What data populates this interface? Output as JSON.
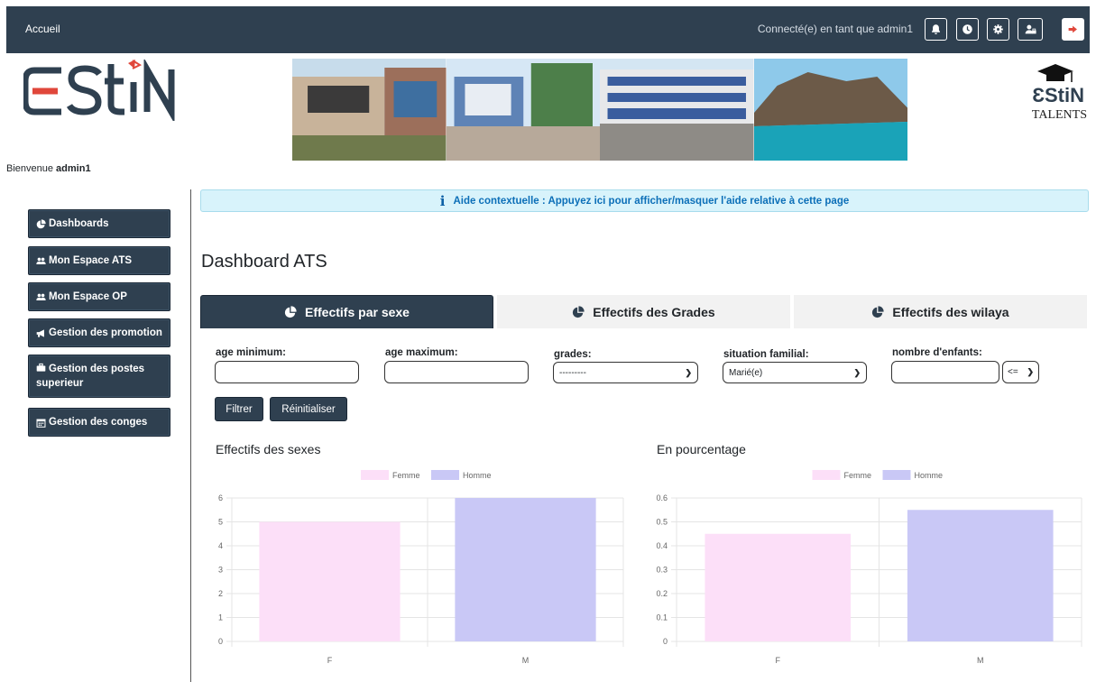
{
  "navbar": {
    "home_label": "Accueil",
    "connected_text": "Connecté(e) en tant que admin1",
    "icons": [
      "bell-icon",
      "clock-icon",
      "gear-icon",
      "user-admin-icon",
      "logout-icon"
    ]
  },
  "header": {
    "logo_text": "ƐStiN",
    "talents_logo_text": "ƐStiN",
    "talents_sub": "TALENTS",
    "welcome_prefix": "Bienvenue ",
    "welcome_user": "admin1"
  },
  "sidebar": {
    "items": [
      {
        "label": "Dashboards",
        "icon": "pie-chart-icon"
      },
      {
        "label": "Mon Espace ATS",
        "icon": "users-icon"
      },
      {
        "label": "Mon Espace OP",
        "icon": "users-icon"
      },
      {
        "label": "Gestion des promotion",
        "icon": "megaphone-icon"
      },
      {
        "label": "Gestion des postes superieur",
        "icon": "briefcase-icon"
      },
      {
        "label": "Gestion des conges",
        "icon": "calendar-icon"
      }
    ]
  },
  "help": {
    "icon": "info-icon",
    "text": "Aide contextuelle : Appuyez ici pour afficher/masquer l'aide relative à cette page"
  },
  "page": {
    "title": "Dashboard ATS"
  },
  "tabs": [
    {
      "label": "Effectifs par sexe",
      "active": true
    },
    {
      "label": "Effectifs des Grades",
      "active": false
    },
    {
      "label": "Effectifs des wilaya",
      "active": false
    }
  ],
  "filters": {
    "age_min_label": "age minimum:",
    "age_min_value": "",
    "age_max_label": "age maximum:",
    "age_max_value": "",
    "grades_label": "grades:",
    "grades_value": "---------",
    "situation_label": "situation familial:",
    "situation_value": "Marié(e)",
    "enfants_label": "nombre d'enfants:",
    "enfants_value": "",
    "operator_value": "<=",
    "filter_button": "Filtrer",
    "reset_button": "Réinitialiser"
  },
  "colors": {
    "navbar": "#2f4050",
    "femme": "#fcdff8",
    "homme": "#c9c8f6"
  },
  "chart_data": [
    {
      "type": "bar",
      "title": "Effectifs des sexes",
      "categories": [
        "F",
        "M"
      ],
      "series": [
        {
          "name": "Femme",
          "values": [
            5,
            null
          ],
          "color": "#fcdff8"
        },
        {
          "name": "Homme",
          "values": [
            null,
            6
          ],
          "color": "#c9c8f6"
        }
      ],
      "ylim": [
        0,
        6
      ],
      "yticks": [
        "0",
        "1",
        "2",
        "3",
        "4",
        "5",
        "6"
      ],
      "legend": "top",
      "grid": true
    },
    {
      "type": "bar",
      "title": "En pourcentage",
      "categories": [
        "F",
        "M"
      ],
      "series": [
        {
          "name": "Femme",
          "values": [
            0.45,
            null
          ],
          "color": "#fcdff8"
        },
        {
          "name": "Homme",
          "values": [
            null,
            0.55
          ],
          "color": "#c9c8f6"
        }
      ],
      "ylim": [
        0,
        0.6
      ],
      "yticks": [
        "0",
        "0.1",
        "0.2",
        "0.3",
        "0.4",
        "0.5",
        "0.6"
      ],
      "legend": "top",
      "grid": true
    }
  ]
}
